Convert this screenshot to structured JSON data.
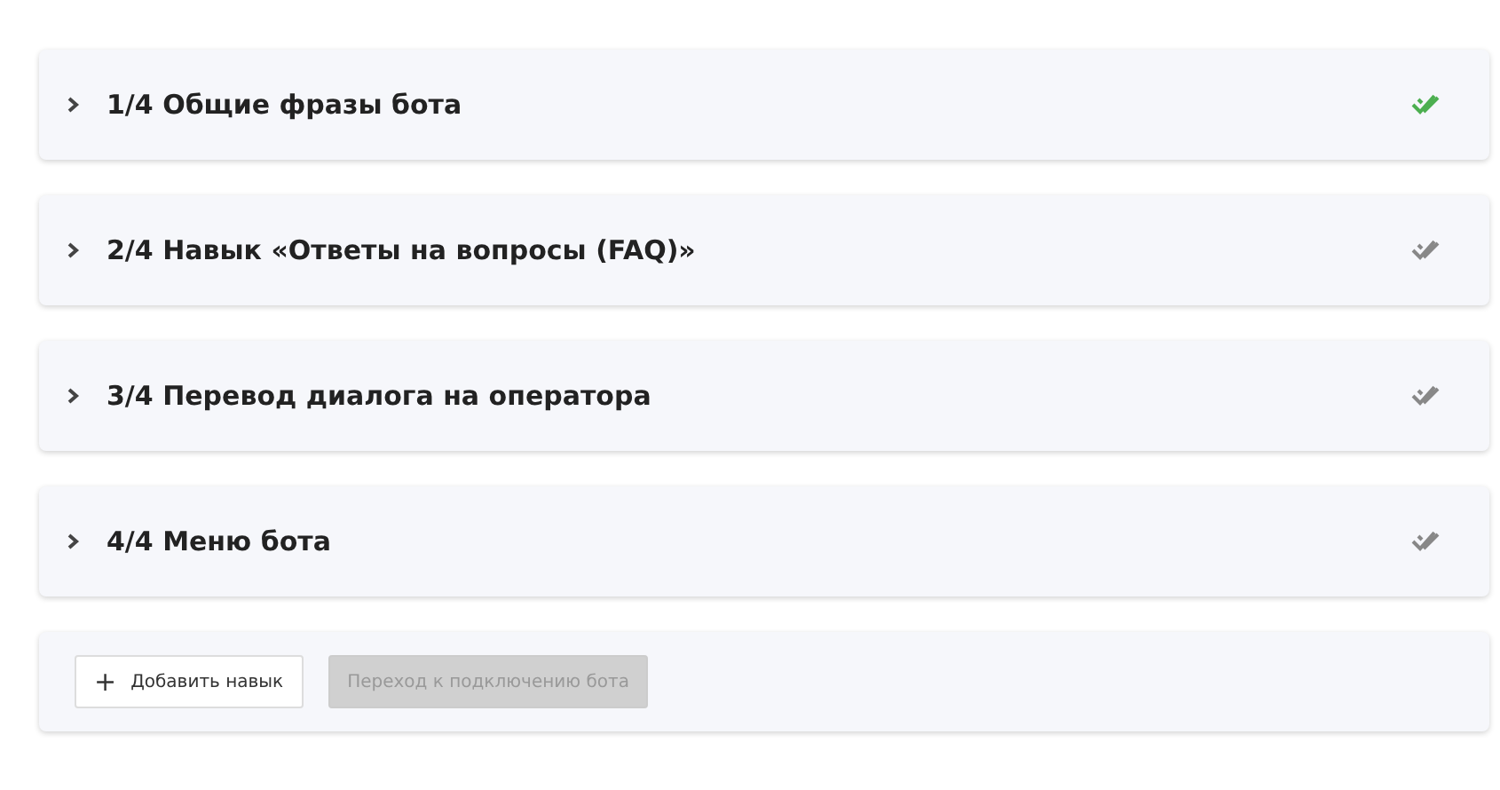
{
  "sections": [
    {
      "title": "1/4 Общие фразы бота",
      "expanded": false,
      "done": true
    },
    {
      "title": "2/4 Навык «Ответы на вопросы (FAQ)»",
      "expanded": false,
      "done": false
    },
    {
      "title": "3/4 Перевод диалога на оператора",
      "expanded": false,
      "done": false
    },
    {
      "title": "4/4 Меню бота",
      "expanded": false,
      "done": false
    }
  ],
  "actions": [
    {
      "label": "+",
      "kind": "icon-text",
      "text": "Добавить навык",
      "disabled": false
    },
    {
      "kind": "text",
      "text": "Переход к подключению бота",
      "disabled": true
    }
  ]
}
